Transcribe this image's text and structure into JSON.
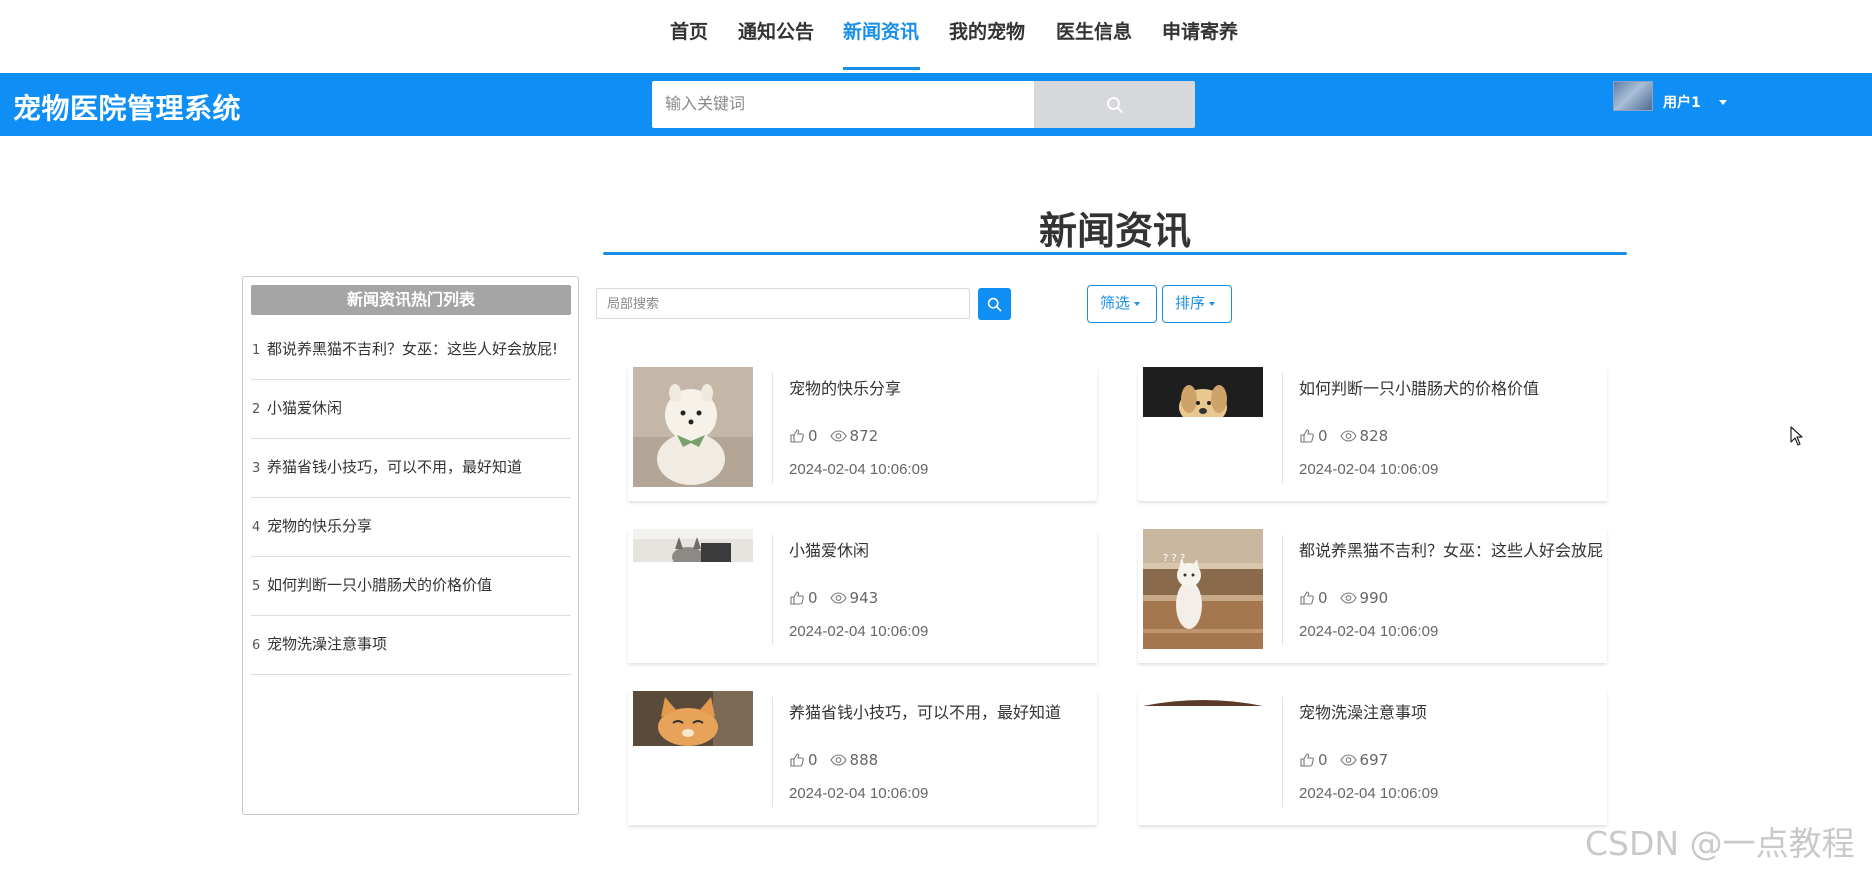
{
  "nav": {
    "items": [
      {
        "label": "首页"
      },
      {
        "label": "通知公告"
      },
      {
        "label": "新闻资讯"
      },
      {
        "label": "我的宠物"
      },
      {
        "label": "医生信息"
      },
      {
        "label": "申请寄养"
      }
    ],
    "active": "新闻资讯"
  },
  "header": {
    "brand": "宠物医院管理系统",
    "search_placeholder": "输入关键词",
    "user_name": "用户1"
  },
  "section": {
    "title": "新闻资讯"
  },
  "sidebar": {
    "title": "新闻资讯热门列表",
    "items": [
      {
        "num": "1",
        "title": "都说养黑猫不吉利？女巫：这些人好会放屁!"
      },
      {
        "num": "2",
        "title": "小猫爱休闲"
      },
      {
        "num": "3",
        "title": "养猫省钱小技巧，可以不用，最好知道"
      },
      {
        "num": "4",
        "title": "宠物的快乐分享"
      },
      {
        "num": "5",
        "title": "如何判断一只小腊肠犬的价格价值"
      },
      {
        "num": "6",
        "title": "宠物洗澡注意事项"
      }
    ]
  },
  "toolbar": {
    "local_search_placeholder": "局部搜索",
    "filter_label": "筛选",
    "sort_label": "排序"
  },
  "cards": [
    {
      "title": "宠物的快乐分享",
      "likes": "0",
      "views": "872",
      "date": "2024-02-04 10:06:09",
      "image": "white-pomeranian-dog"
    },
    {
      "title": "如何判断一只小腊肠犬的价格价值",
      "likes": "0",
      "views": "828",
      "date": "2024-02-04 10:06:09",
      "image": "puppy-partially-loaded"
    },
    {
      "title": "小猫爱休闲",
      "likes": "0",
      "views": "943",
      "date": "2024-02-04 10:06:09",
      "image": "kitten-partially-loaded"
    },
    {
      "title": "都说养黑猫不吉利？女巫：这些人好会放屁",
      "likes": "0",
      "views": "990",
      "date": "2024-02-04 10:06:09",
      "image": "white-cat-on-stairs"
    },
    {
      "title": "养猫省钱小技巧，可以不用，最好知道",
      "likes": "0",
      "views": "888",
      "date": "2024-02-04 10:06:09",
      "image": "orange-cat-partially-loaded"
    },
    {
      "title": "宠物洗澡注意事项",
      "likes": "0",
      "views": "697",
      "date": "2024-02-04 10:06:09",
      "image": "pet-image-partially-loaded"
    }
  ],
  "watermark": "CSDN @一点教程",
  "colors": {
    "primary": "#0f8ff5",
    "accent": "#1a8fe8",
    "search_button": "#d6d8dc",
    "sidebar_title_bg": "#a5a5a5"
  }
}
